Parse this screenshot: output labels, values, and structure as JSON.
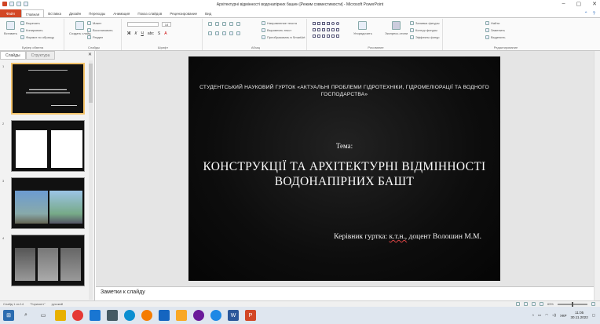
{
  "window": {
    "title": "Архітектурні відмінності водонапірних башен [Режим совместимости] - Microsoft PowerPoint",
    "controls": [
      "–",
      "▢",
      "✕"
    ]
  },
  "ribbon_tabs": [
    {
      "label": "Файл"
    },
    {
      "label": "Главная"
    },
    {
      "label": "Вставка"
    },
    {
      "label": "Дизайн"
    },
    {
      "label": "Переходы"
    },
    {
      "label": "Анимация"
    },
    {
      "label": "Показ слайдов"
    },
    {
      "label": "Рецензирование"
    },
    {
      "label": "Вид"
    }
  ],
  "ribbon": {
    "clipboard": {
      "paste": "Вставить",
      "cut": "Вырезать",
      "copy": "Копировать",
      "format": "Формат по образцу",
      "label": "Буфер обмена"
    },
    "slides": {
      "create": "Создать слайд",
      "layout": "Макет",
      "reset": "Восстановить",
      "section": "Раздел",
      "label": "Слайды"
    },
    "font": {
      "label": "Шрифт",
      "size": "18"
    },
    "paragraph": {
      "label": "Абзац",
      "dir": "Направление текста",
      "align": "Выровнять текст",
      "smart": "Преобразовать в SmartArt"
    },
    "drawing": {
      "arrange": "Упорядочить",
      "styles": "Экспресс-стили",
      "fill": "Заливка фигуры",
      "outline": "Контур фигуры",
      "effects": "Эффекты фигур",
      "label": "Рисование"
    },
    "editing": {
      "find": "Найти",
      "replace": "Заменить",
      "select": "Выделить",
      "label": "Редактирование"
    }
  },
  "panel": {
    "tab_slides": "Слайды",
    "tab_outline": "Структура",
    "close": "✕"
  },
  "thumbnails": [
    {
      "num": "1"
    },
    {
      "num": "2"
    },
    {
      "num": "3"
    },
    {
      "num": "4"
    }
  ],
  "slide": {
    "org": "СТУДЕНТСЬКИЙ НАУКОВИЙ ГУРТОК «АКТУАЛЬНІ ПРОБЛЕМИ ГІДРОТЕХНІКИ, ГІДРОМЕЛІОРАЦІЇ ТА ВОДНОГО ГОСПОДАРСТВА»",
    "topic": "Тема:",
    "title": "КОНСТРУКЦІЇ ТА АРХІТЕКТУРНІ ВІДМІННОСТІ ВОДОНАПІРНИХ БАШТ",
    "leader_prefix": "Керівник гуртка:",
    "leader_degree": "к.т.н.,",
    "leader_name": "доцент Волошин М.М."
  },
  "notes": {
    "placeholder": "Заметки к слайду"
  },
  "status": {
    "slide": "Слайд 1 из 14",
    "theme": "\"Горизонт\"",
    "lang": "русский",
    "zoom": "65%"
  },
  "taskbar": {
    "lang": "УКР",
    "time": "11:05",
    "date": "30.11.2022"
  },
  "colors": {
    "file_tab": "#d24726",
    "selection": "#f4c36a"
  }
}
